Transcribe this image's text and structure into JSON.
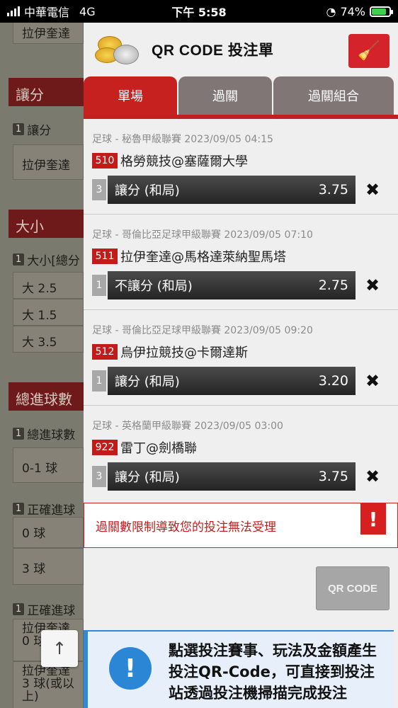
{
  "status_bar": {
    "carrier": "中華電信",
    "network": "4G",
    "time": "下午 5:58",
    "battery": "74%"
  },
  "background": {
    "top_row": "拉伊奎達",
    "section1_title": "讓分",
    "section1_label": "讓分",
    "section1_row": "拉伊奎達",
    "section2_title": "大小",
    "section2_label": "大小[總分",
    "section2_rows": [
      "大 2.5",
      "大 1.5",
      "大 3.5"
    ],
    "section3_title": "總進球數",
    "section3_label": "總進球數",
    "section3_row": "0-1 球",
    "section4_label": "正確進球",
    "section4_rows": [
      "0 球",
      "3 球"
    ],
    "section5_label": "正確進球",
    "section5_rows": [
      "拉伊奎達 0 球",
      "拉伊奎達 3 球(或以上)"
    ],
    "label_num": "1",
    "up_arrow": "↑"
  },
  "panel": {
    "title": "QR CODE 投注單",
    "tabs": [
      "單場",
      "過關",
      "過關組合"
    ],
    "bets": [
      {
        "meta": "足球 - 秘魯甲級聯賽 2023/09/05 04:15",
        "match_no": "510",
        "match": "格勞競技@塞薩爾大學",
        "sel_num": "3",
        "selection": "讓分 (和局)",
        "odds": "3.75"
      },
      {
        "meta": "足球 - 哥倫比亞足球甲級聯賽 2023/09/05 07:10",
        "match_no": "511",
        "match": "拉伊奎達@馬格達萊納聖馬塔",
        "sel_num": "1",
        "selection": "不讓分 (和局)",
        "odds": "2.75"
      },
      {
        "meta": "足球 - 哥倫比亞足球甲級聯賽 2023/09/05 09:20",
        "match_no": "512",
        "match": "烏伊拉競技@卡爾達斯",
        "sel_num": "1",
        "selection": "讓分 (和局)",
        "odds": "3.20"
      },
      {
        "meta": "足球 - 英格蘭甲級聯賽 2023/09/05 03:00",
        "match_no": "922",
        "match": "雷丁@劍橋聯",
        "sel_num": "3",
        "selection": "讓分 (和局)",
        "odds": "3.75"
      }
    ],
    "error": "過關數限制導致您的投注無法受理",
    "qr_button": "QR CODE",
    "info": "點選投注賽事、玩法及金額產生投注QR-Code，可直接到投注站透過投注機掃描完成投注"
  }
}
